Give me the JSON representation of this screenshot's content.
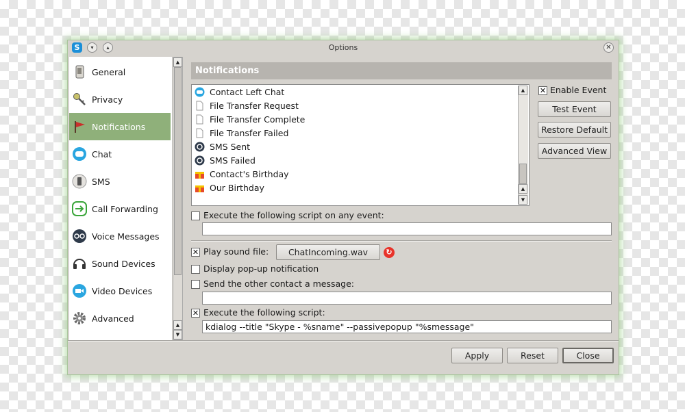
{
  "window": {
    "title": "Options"
  },
  "colors": {
    "accent": "#8fb07a",
    "header": "#b7b4af",
    "window_bg": "#d6d3ce"
  },
  "sidebar": {
    "items": [
      {
        "label": "General",
        "icon": "phone-icon"
      },
      {
        "label": "Privacy",
        "icon": "keys-icon"
      },
      {
        "label": "Notifications",
        "icon": "flag-icon"
      },
      {
        "label": "Chat",
        "icon": "chat-bubble-icon"
      },
      {
        "label": "SMS",
        "icon": "mobile-phone-icon"
      },
      {
        "label": "Call Forwarding",
        "icon": "call-forward-icon"
      },
      {
        "label": "Voice Messages",
        "icon": "voicemail-icon"
      },
      {
        "label": "Sound Devices",
        "icon": "headset-icon"
      },
      {
        "label": "Video Devices",
        "icon": "video-camera-icon"
      },
      {
        "label": "Advanced",
        "icon": "gear-icon"
      }
    ],
    "active_index": 2
  },
  "main": {
    "header": "Notifications",
    "events": [
      {
        "label": "Contact Left Chat",
        "icon": "chat-icon"
      },
      {
        "label": "File Transfer Request",
        "icon": "file-icon"
      },
      {
        "label": "File Transfer Complete",
        "icon": "file-icon"
      },
      {
        "label": "File Transfer Failed",
        "icon": "file-icon"
      },
      {
        "label": "SMS Sent",
        "icon": "sms-icon"
      },
      {
        "label": "SMS Failed",
        "icon": "sms-icon"
      },
      {
        "label": "Contact's Birthday",
        "icon": "gift-icon"
      },
      {
        "label": "Our Birthday",
        "icon": "gift-icon"
      }
    ],
    "enable_event": {
      "label": "Enable Event",
      "checked": true
    },
    "buttons": {
      "test_event": "Test Event",
      "restore_default": "Restore Default",
      "advanced_view": "Advanced View"
    },
    "script_any_event": {
      "label": "Execute the following script on any event:",
      "checked": false,
      "value": ""
    },
    "play_sound": {
      "label": "Play sound file:",
      "checked": true,
      "file": "ChatIncoming.wav"
    },
    "popup": {
      "label": "Display pop-up notification",
      "checked": false
    },
    "send_message": {
      "label": "Send the other contact a message:",
      "checked": false,
      "value": ""
    },
    "execute_script": {
      "label": "Execute the following script:",
      "checked": true,
      "value": "kdialog --title \"Skype - %sname\" --passivepopup \"%smessage\""
    }
  },
  "footer": {
    "apply": "Apply",
    "reset": "Reset",
    "close": "Close"
  }
}
